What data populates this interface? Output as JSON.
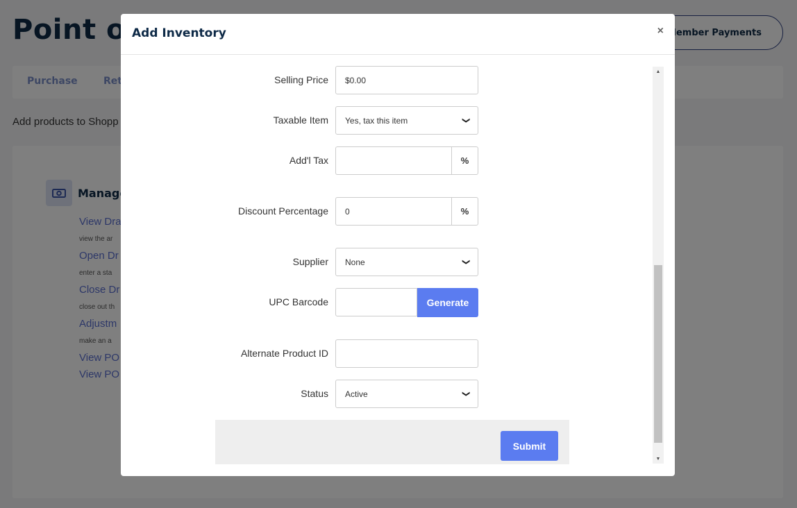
{
  "background": {
    "page_title": "Point of",
    "member_payments_label": "Member Payments",
    "tabs": [
      {
        "label": "Purchase"
      },
      {
        "label": "Ret"
      }
    ],
    "intro_text": "Add products to Shopp",
    "card": {
      "icon": "money-icon",
      "title": "Manage",
      "links": [
        {
          "label": "View Dra",
          "description": "view the ar"
        },
        {
          "label": "Open Dr",
          "description": "enter a sta"
        },
        {
          "label": "Close Dr",
          "description": "close out th"
        },
        {
          "label": "Adjustm",
          "description": "make an a"
        },
        {
          "label": "View PO",
          "description": ""
        },
        {
          "label": "View PO",
          "description": ""
        }
      ]
    }
  },
  "modal": {
    "title": "Add Inventory",
    "close_label": "×",
    "fields": {
      "selling_price": {
        "label": "Selling Price",
        "value": "$0.00"
      },
      "taxable_item": {
        "label": "Taxable Item",
        "value": "Yes, tax this item"
      },
      "addl_tax": {
        "label": "Add'l Tax",
        "value": "",
        "addon": "%"
      },
      "discount_percentage": {
        "label": "Discount Percentage",
        "value": "0",
        "addon": "%"
      },
      "supplier": {
        "label": "Supplier",
        "value": "None"
      },
      "upc_barcode": {
        "label": "UPC Barcode",
        "value": "",
        "button": "Generate"
      },
      "alternate_product_id": {
        "label": "Alternate Product ID",
        "value": ""
      },
      "status": {
        "label": "Status",
        "value": "Active"
      }
    },
    "submit_label": "Submit"
  }
}
